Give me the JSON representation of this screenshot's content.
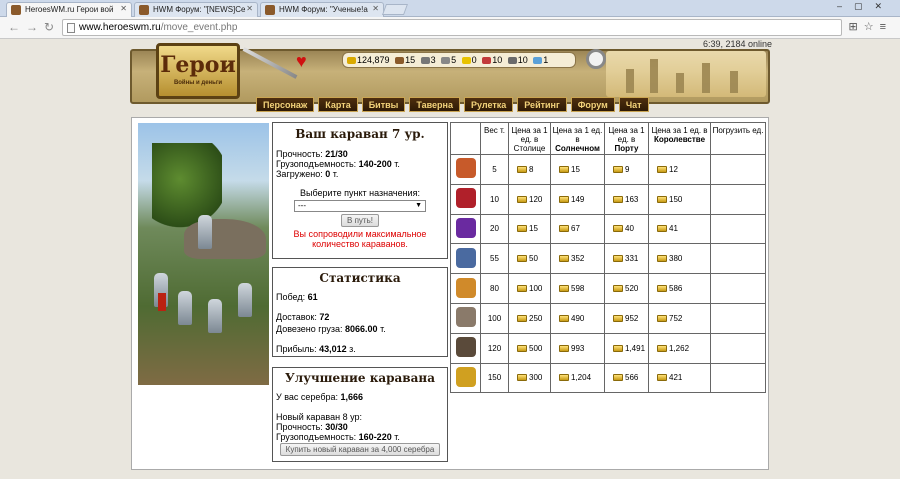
{
  "browser": {
    "tabs": [
      {
        "title": "HeroesWM.ru Герои вой",
        "active": true
      },
      {
        "title": "HWM Форум: \"[NEWS]Се",
        "active": false
      },
      {
        "title": "HWM Форум: \"Ученые!а",
        "active": false
      }
    ],
    "url_host": "www.heroeswm.ru",
    "url_path": "/move_event.php"
  },
  "header": {
    "logo_title": "Герои",
    "logo_subtitle": "Войны и деньги",
    "online_text": "6:39, 2184 online",
    "resources": [
      {
        "name": "gold",
        "value": "124,879",
        "color": "#d9a900"
      },
      {
        "name": "wood",
        "value": "15",
        "color": "#8a5a2b"
      },
      {
        "name": "ore",
        "value": "3",
        "color": "#777777"
      },
      {
        "name": "mercury",
        "value": "5",
        "color": "#888888"
      },
      {
        "name": "sulfur",
        "value": "0",
        "color": "#e8c200"
      },
      {
        "name": "crystal",
        "value": "10",
        "color": "#c23a3a"
      },
      {
        "name": "gems",
        "value": "10",
        "color": "#6a6a6a"
      },
      {
        "name": "diamond",
        "value": "1",
        "color": "#5aa0d8"
      }
    ],
    "menu": [
      "Персонаж",
      "Карта",
      "Битвы",
      "Таверна",
      "Рулетка",
      "Рейтинг",
      "Форум",
      "Чат"
    ]
  },
  "caravan": {
    "title": "Ваш караван 7 ур.",
    "durability_label": "Прочность:",
    "durability_value": "21/30",
    "capacity_label": "Грузоподъемность:",
    "capacity_value": "140-200",
    "capacity_unit": "т.",
    "loaded_label": "Загружено:",
    "loaded_value": "0",
    "loaded_unit": "т.",
    "choose_label": "Выберите пункт назначения:",
    "select_value": "---",
    "go_button": "В путь!",
    "warning": "Вы сопроводили максимальное количество караванов."
  },
  "stats": {
    "title": "Статистика",
    "wins_label": "Побед:",
    "wins_value": "61",
    "deliveries_label": "Доставок:",
    "deliveries_value": "72",
    "cargo_label": "Довезено груза:",
    "cargo_value": "8066.00",
    "cargo_unit": "т.",
    "profit_label": "Прибыль:",
    "profit_value": "43,012",
    "profit_unit": "з."
  },
  "upgrade": {
    "title": "Улучшение каравана",
    "silver_label": "У вас серебра:",
    "silver_value": "1,666",
    "new_caravan": "Новый караван 8 ур:",
    "durability_label": "Прочность:",
    "durability_value": "30/30",
    "capacity_label": "Грузоподъемность:",
    "capacity_value": "160-220",
    "capacity_unit": "т.",
    "buy_button": "Купить новый караван за 4,000 серебра"
  },
  "goods_table": {
    "headers": {
      "weight": "Вес т.",
      "capital_line": "Цена за 1 ед. в Столице",
      "sunny_line": "Цена за 1 ед. в",
      "sunny_name": "Солнечном",
      "port_line": "Цена за 1 ед. в",
      "port_name": "Порту",
      "kingdom_line": "Цена за 1 ед. в",
      "kingdom_name": "Королевстве",
      "load": "Погрузить ед."
    },
    "rows": [
      {
        "icon": "fruit-bag-icon",
        "color": "#c75a2a",
        "weight": "5",
        "capital": "8",
        "sunny": "15",
        "port": "9",
        "kingdom": "12"
      },
      {
        "icon": "potion-icon",
        "color": "#b0202a",
        "weight": "10",
        "capital": "120",
        "sunny": "149",
        "port": "163",
        "kingdom": "150"
      },
      {
        "icon": "vials-icon",
        "color": "#6a2aa0",
        "weight": "20",
        "capital": "15",
        "sunny": "67",
        "port": "40",
        "kingdom": "41"
      },
      {
        "icon": "cloth-icon",
        "color": "#4a6aa0",
        "weight": "55",
        "capital": "50",
        "sunny": "352",
        "port": "331",
        "kingdom": "380"
      },
      {
        "icon": "spices-icon",
        "color": "#d08a2a",
        "weight": "80",
        "capital": "100",
        "sunny": "598",
        "port": "520",
        "kingdom": "586"
      },
      {
        "icon": "sack-icon",
        "color": "#8a7a6a",
        "weight": "100",
        "capital": "250",
        "sunny": "490",
        "port": "952",
        "kingdom": "752"
      },
      {
        "icon": "weapons-icon",
        "color": "#5a4a3a",
        "weight": "120",
        "capital": "500",
        "sunny": "993",
        "port": "1,491",
        "kingdom": "1,262"
      },
      {
        "icon": "ring-icon",
        "color": "#d0a020",
        "weight": "150",
        "capital": "300",
        "sunny": "1,204",
        "port": "566",
        "kingdom": "421"
      }
    ]
  }
}
